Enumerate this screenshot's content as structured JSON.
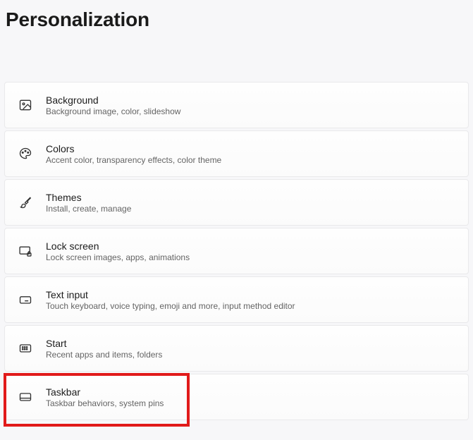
{
  "page": {
    "title": "Personalization"
  },
  "items": [
    {
      "icon": "image-icon",
      "title": "Background",
      "subtitle": "Background image, color, slideshow"
    },
    {
      "icon": "palette-icon",
      "title": "Colors",
      "subtitle": "Accent color, transparency effects, color theme"
    },
    {
      "icon": "brush-icon",
      "title": "Themes",
      "subtitle": "Install, create, manage"
    },
    {
      "icon": "lock-screen-icon",
      "title": "Lock screen",
      "subtitle": "Lock screen images, apps, animations"
    },
    {
      "icon": "keyboard-icon",
      "title": "Text input",
      "subtitle": "Touch keyboard, voice typing, emoji and more, input method editor"
    },
    {
      "icon": "start-icon",
      "title": "Start",
      "subtitle": "Recent apps and items, folders"
    },
    {
      "icon": "taskbar-icon",
      "title": "Taskbar",
      "subtitle": "Taskbar behaviors, system pins",
      "highlight": true
    }
  ]
}
